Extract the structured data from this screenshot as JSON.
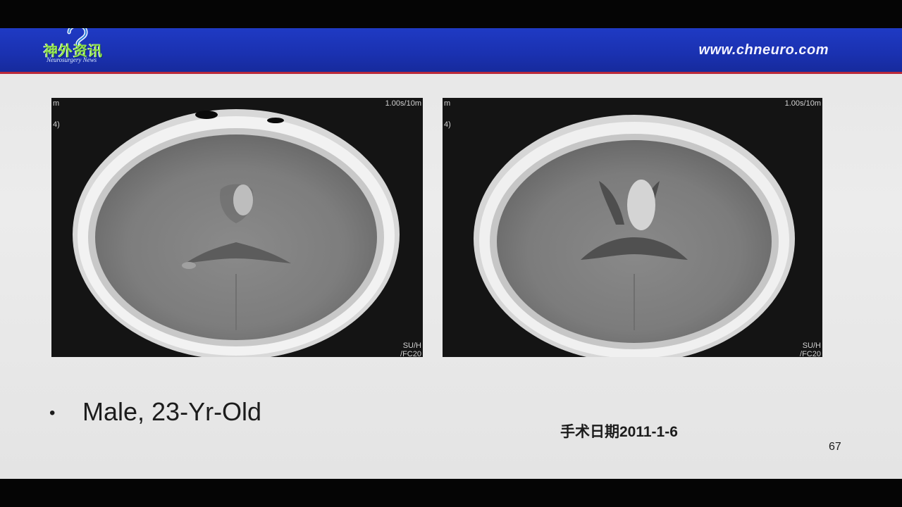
{
  "header": {
    "logo_cn": "神外资讯",
    "logo_en": "Neurosurgery News",
    "site_url": "www.chneuro.com",
    "brand_color": "#1f3ac4",
    "accent_line_color": "#b9283a"
  },
  "images": {
    "left": {
      "corner_top_left": "m",
      "corner_top_left_2": "4)",
      "corner_top_right": "1.00s/10m",
      "corner_bottom_right_1": "SU/H",
      "corner_bottom_right_2": "/FC20"
    },
    "right": {
      "corner_top_left": "m",
      "corner_top_left_2": "4)",
      "corner_top_right": "1.00s/10m",
      "corner_bottom_right_1": "SU/H",
      "corner_bottom_right_2": "/FC20"
    }
  },
  "content": {
    "bullet_marker": "•",
    "bullet_text": "Male, 23-Yr-Old",
    "surgery_date": "手术日期2011-1-6",
    "page_number": "67"
  }
}
